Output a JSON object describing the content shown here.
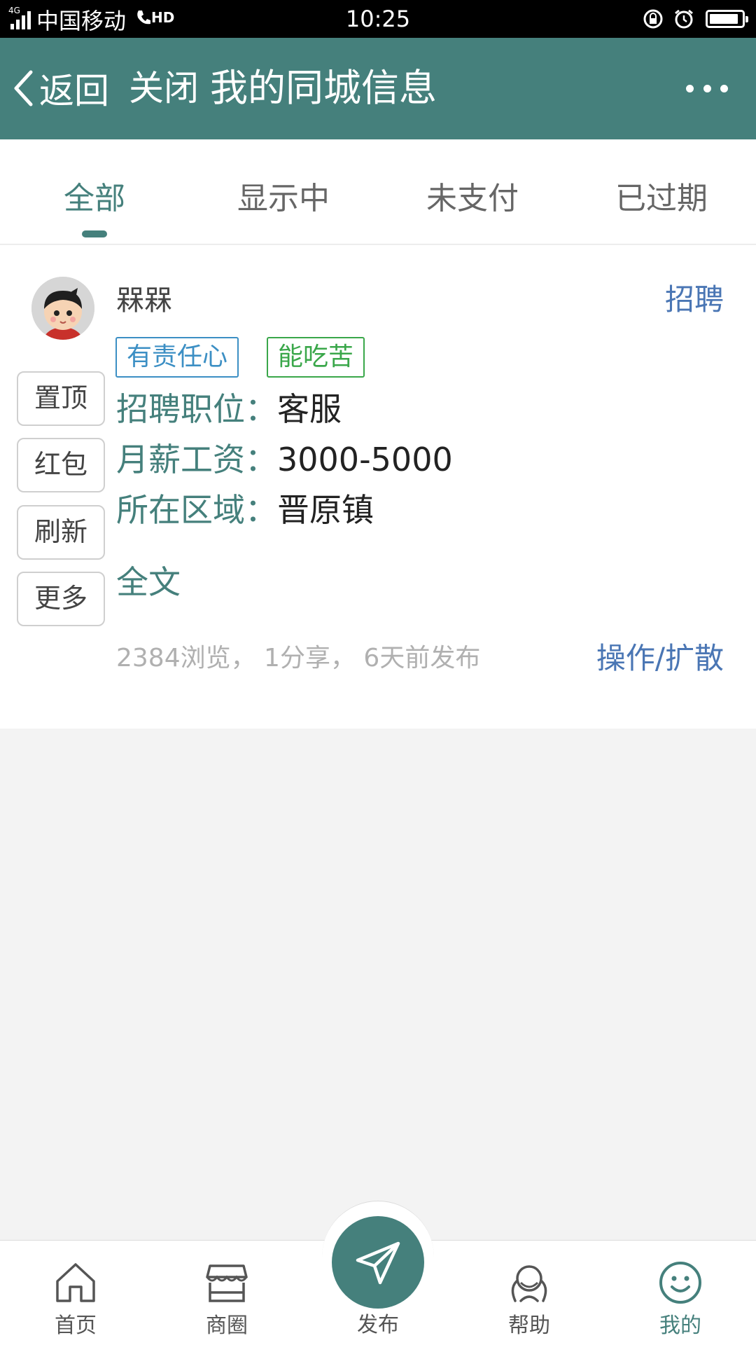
{
  "status_bar": {
    "network": "4G",
    "carrier": "中国移动",
    "hd": "HD",
    "time": "10:25",
    "battery_level": 0.9
  },
  "header": {
    "back_label": "返回",
    "close_label": "关闭",
    "title": "我的同城信息"
  },
  "tabs": [
    {
      "label": "全部",
      "active": true
    },
    {
      "label": "显示中",
      "active": false
    },
    {
      "label": "未支付",
      "active": false
    },
    {
      "label": "已过期",
      "active": false
    }
  ],
  "post": {
    "username": "槑槑",
    "category": "招聘",
    "tags": [
      {
        "label": "有责任心",
        "color": "#3c8fc4"
      },
      {
        "label": "能吃苦",
        "color": "#3aa74a"
      }
    ],
    "actions": [
      "置顶",
      "红包",
      "刷新",
      "更多"
    ],
    "fields": [
      {
        "label": "招聘职位：",
        "value": "客服"
      },
      {
        "label": "月薪工资：",
        "value": "3000-5000"
      },
      {
        "label": "所在区域：",
        "value": "晋原镇"
      }
    ],
    "fulltext_label": "全文",
    "meta": "2384浏览， 1分享， 6天前发布",
    "operation_label": "操作/扩散"
  },
  "bottom_nav": {
    "items": [
      {
        "label": "首页",
        "icon": "home-icon"
      },
      {
        "label": "商圈",
        "icon": "store-icon"
      },
      {
        "label": "发布",
        "icon": "send-icon"
      },
      {
        "label": "帮助",
        "icon": "help-icon"
      },
      {
        "label": "我的",
        "icon": "smile-icon",
        "active": true
      }
    ]
  },
  "colors": {
    "primary": "#45807c",
    "link_blue": "#4a76b4",
    "background": "#f3f3f3"
  }
}
